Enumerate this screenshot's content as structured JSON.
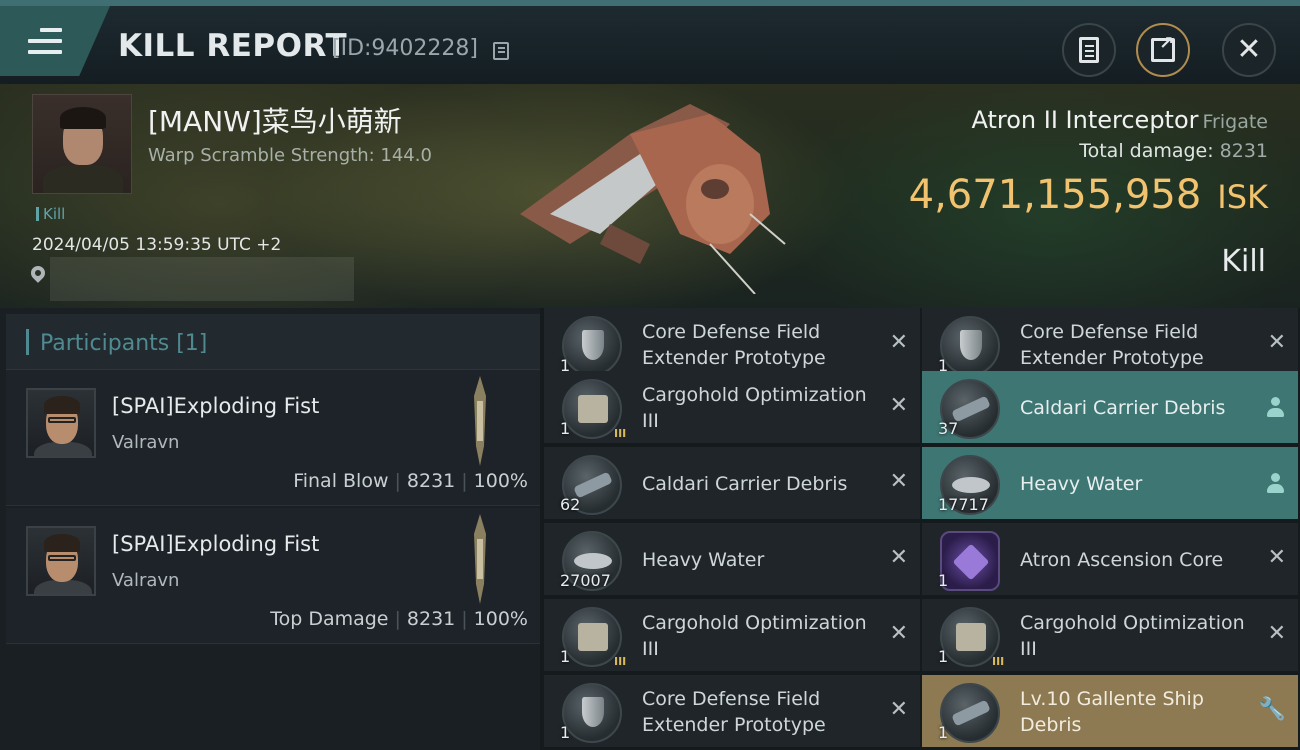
{
  "header": {
    "title": "KILL REPORT",
    "report_id": "[ID:9402228]"
  },
  "victim": {
    "name": "[MANW]菜鸟小萌新",
    "warp_scramble": "Warp Scramble Strength: 144.0",
    "kill_tag": "Kill",
    "datetime": "2024/04/05 13:59:35 UTC +2"
  },
  "ship": {
    "name": "Atron II Interceptor",
    "class": "Frigate",
    "total_damage_label": "Total damage:",
    "total_damage_value": "8231",
    "isk_value": "4,671,155,958",
    "isk_unit": "ISK",
    "result": "Kill"
  },
  "participants": {
    "header": "Participants [1]",
    "rows": [
      {
        "name": "[SPAI]Exploding Fist",
        "ship": "Valravn",
        "role": "Final Blow",
        "damage": "8231",
        "percent": "100%"
      },
      {
        "name": "[SPAI]Exploding Fist",
        "ship": "Valravn",
        "role": "Top Damage",
        "damage": "8231",
        "percent": "100%"
      }
    ]
  },
  "items": [
    {
      "name": "Core Defense Field Extender Prototype",
      "qty": "1",
      "icon": "shield-icon",
      "state": "destroyed"
    },
    {
      "name": "Core Defense Field Extender Prototype",
      "qty": "1",
      "icon": "shield-icon",
      "state": "destroyed"
    },
    {
      "name": "Cargohold Optimization III",
      "qty": "1",
      "icon": "cargo-module-icon",
      "state": "destroyed"
    },
    {
      "name": "Caldari Carrier Debris",
      "qty": "37",
      "icon": "debris-icon",
      "state": "dropped"
    },
    {
      "name": "Caldari Carrier Debris",
      "qty": "62",
      "icon": "debris-icon",
      "state": "destroyed"
    },
    {
      "name": "Heavy Water",
      "qty": "17717",
      "icon": "heavy-water-icon",
      "state": "dropped"
    },
    {
      "name": "Heavy Water",
      "qty": "27007",
      "icon": "heavy-water-icon",
      "state": "destroyed"
    },
    {
      "name": "Atron Ascension Core",
      "qty": "1",
      "icon": "ascension-core-icon",
      "state": "destroyed"
    },
    {
      "name": "Cargohold Optimization III",
      "qty": "1",
      "icon": "cargo-module-icon",
      "state": "destroyed"
    },
    {
      "name": "Cargohold Optimization III",
      "qty": "1",
      "icon": "cargo-module-icon",
      "state": "destroyed"
    },
    {
      "name": "Core Defense Field Extender Prototype",
      "qty": "1",
      "icon": "shield-icon",
      "state": "destroyed"
    },
    {
      "name": "Lv.10 Gallente Ship Debris",
      "qty": "1",
      "icon": "debris-icon",
      "state": "special"
    }
  ],
  "colors": {
    "accent_teal": "#3e7674",
    "isk_gold": "#f2c36e",
    "special_gold": "#8d7a53"
  }
}
